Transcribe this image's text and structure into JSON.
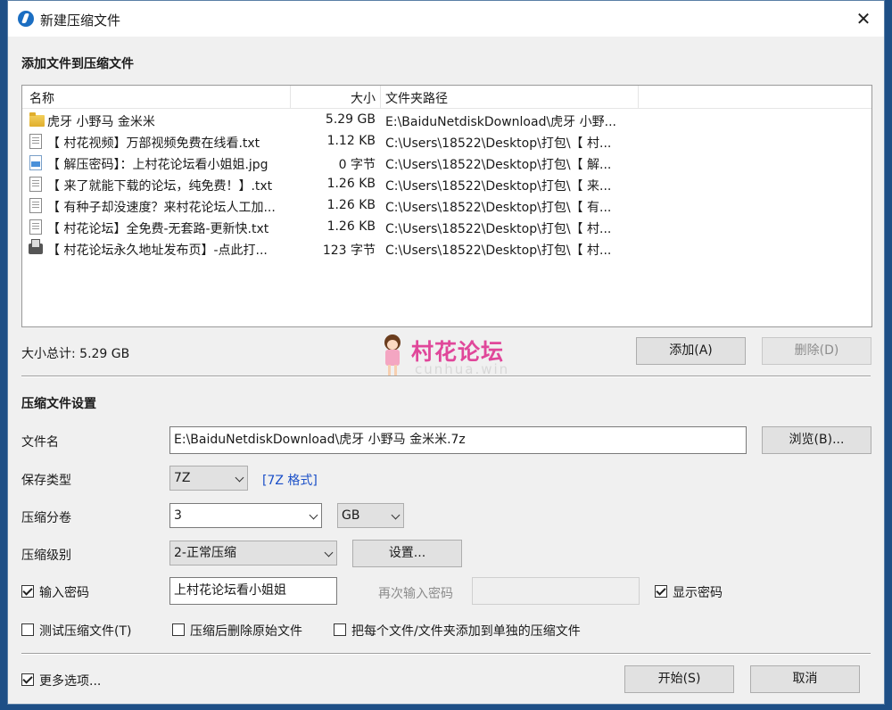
{
  "window": {
    "title": "新建压缩文件",
    "close": "✕"
  },
  "files_section": {
    "title": "添加文件到压缩文件",
    "columns": {
      "name": "名称",
      "size": "大小",
      "path": "文件夹路径"
    },
    "rows": [
      {
        "icon": "folder-icon",
        "name": "虎牙 小野马  金米米",
        "size": "5.29 GB",
        "path": "E:\\BaiduNetdiskDownload\\虎牙 小野..."
      },
      {
        "icon": "txt-file-icon",
        "name": "【 村花视频】万部视频免费在线看.txt",
        "size": "1.12 KB",
        "path": "C:\\Users\\18522\\Desktop\\打包\\【 村..."
      },
      {
        "icon": "jpg-file-icon",
        "name": "【 解压密码】：上村花论坛看小姐姐.jpg",
        "size": "0 字节",
        "path": "C:\\Users\\18522\\Desktop\\打包\\【 解..."
      },
      {
        "icon": "txt-file-icon",
        "name": "【 来了就能下载的论坛，纯免费！】.txt",
        "size": "1.26 KB",
        "path": "C:\\Users\\18522\\Desktop\\打包\\【 来..."
      },
      {
        "icon": "txt-file-icon",
        "name": "【 有种子却没速度？来村花论坛人工加...",
        "size": "1.26 KB",
        "path": "C:\\Users\\18522\\Desktop\\打包\\【 有..."
      },
      {
        "icon": "txt-file-icon",
        "name": "【 村花论坛】全免费-无套路-更新快.txt",
        "size": "1.26 KB",
        "path": "C:\\Users\\18522\\Desktop\\打包\\【 村..."
      },
      {
        "icon": "url-shortcut-icon",
        "name": "【 村花论坛永久地址发布页】-点此打...",
        "size": "123 字节",
        "path": "C:\\Users\\18522\\Desktop\\打包\\【 村..."
      }
    ],
    "total": "大小总计: 5.29 GB",
    "add_button": "添加(A)",
    "delete_button": "删除(D)"
  },
  "watermark": {
    "text": "村花论坛",
    "sub": "cunhua.win"
  },
  "settings": {
    "title": "压缩文件设置",
    "filename_label": "文件名",
    "filename_value": "E:\\BaiduNetdiskDownload\\虎牙 小野马  金米米.7z",
    "browse_button": "浏览(B)...",
    "type_label": "保存类型",
    "type_value": "7Z",
    "type_link": "[7Z 格式]",
    "split_label": "压缩分卷",
    "split_value": "3",
    "split_unit": "GB",
    "level_label": "压缩级别",
    "level_value": "2-正常压缩",
    "level_settings_button": "设置...",
    "password_label": "输入密码",
    "password_value": "上村花论坛看小姐姐",
    "password_checked": true,
    "reenter_label": "再次输入密码",
    "reenter_value": "",
    "show_password_label": "显示密码",
    "show_password_checked": true,
    "test_label": "测试压缩文件(T)",
    "test_checked": false,
    "delete_after_label": "压缩后删除原始文件",
    "delete_after_checked": false,
    "each_separate_label": "把每个文件/文件夹添加到单独的压缩文件",
    "each_separate_checked": false
  },
  "footer": {
    "more_options_label": "更多选项...",
    "more_options_checked": true,
    "start_button": "开始(S)",
    "cancel_button": "取消"
  }
}
